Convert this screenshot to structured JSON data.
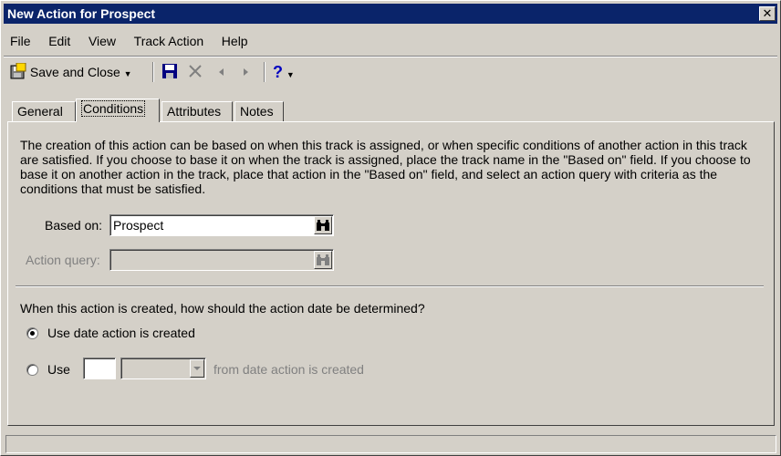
{
  "window": {
    "title": "New Action for Prospect"
  },
  "menu": [
    "File",
    "Edit",
    "View",
    "Track Action",
    "Help"
  ],
  "toolbar": {
    "save_close_label": "Save and Close",
    "help_glyph": "?"
  },
  "tabs": [
    "General",
    "Conditions",
    "Attributes",
    "Notes"
  ],
  "active_tab": "Conditions",
  "conditions": {
    "description": "The creation of this action can be based on when this track is assigned, or when specific conditions of another action in this track are satisfied. If you choose to base it on when the track is assigned, place the track name in the \"Based on\" field. If you choose to base it on another action in the track, place that action in the \"Based on\" field, and select an action query with criteria as the conditions that must be satisfied.",
    "based_on_label": "Based on:",
    "based_on_value": "Prospect",
    "action_query_label": "Action query:",
    "action_query_value": "",
    "date_question": "When this action is created, how should the action date be determined?",
    "option_created_label": "Use date action is created",
    "option_use_label": "Use",
    "offset_value": "",
    "unit_value": "",
    "offset_suffix": "from date action is created",
    "selected_option": "created"
  },
  "colors": {
    "titlebar": "#0a246a",
    "face": "#d4d0c8",
    "disabled_text": "#808080"
  }
}
